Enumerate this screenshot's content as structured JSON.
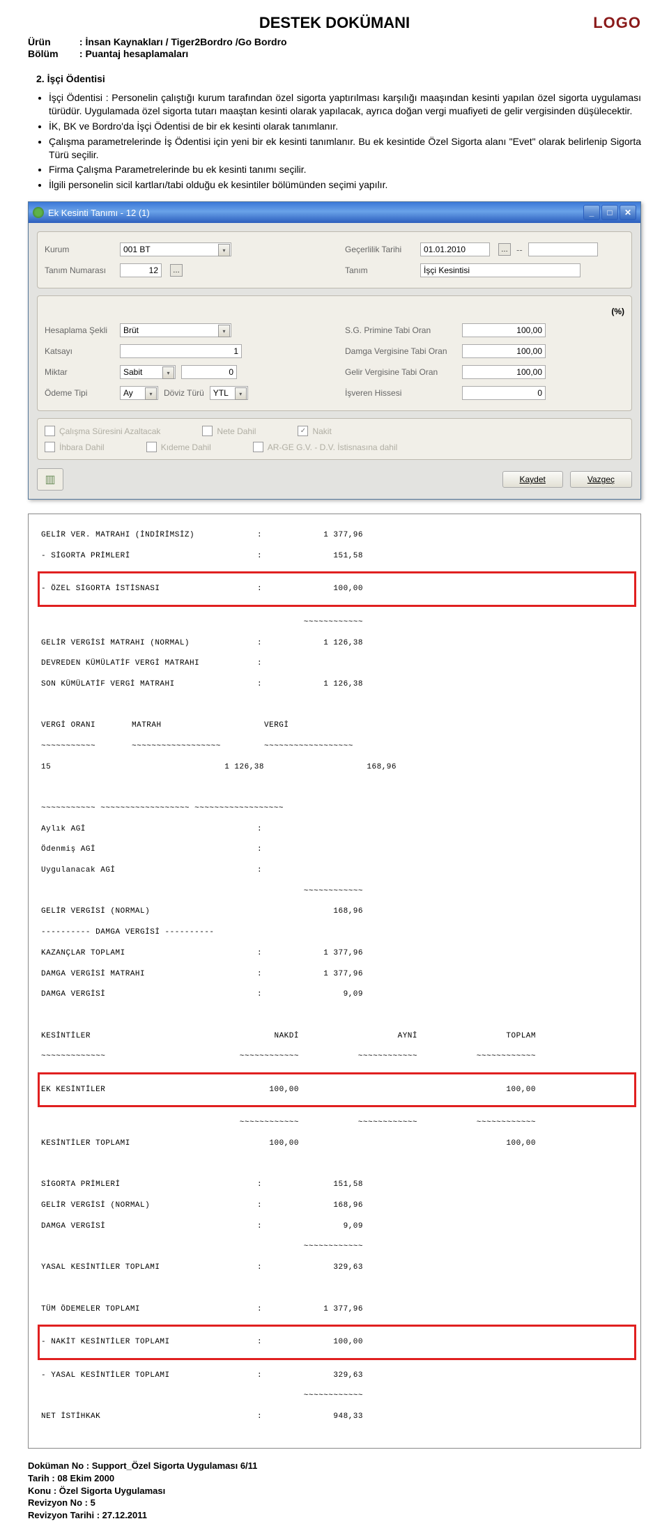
{
  "header": {
    "title": "DESTEK DOKÜMANI",
    "logo": "LOGO",
    "urun_label": "Ürün",
    "urun_value": ": İnsan Kaynakları / Tiger2Bordro /Go Bordro",
    "bolum_label": "Bölüm",
    "bolum_value": ": Puantaj hesaplamaları"
  },
  "section": {
    "heading": "2. İşçi Ödentisi",
    "bullets": [
      "İşçi Ödentisi : Personelin çalıştığı kurum tarafından özel sigorta yaptırılması karşılığı maaşından kesinti yapılan özel sigorta uygulaması türüdür. Uygulamada özel sigorta tutarı maaştan kesinti olarak yapılacak, ayrıca doğan vergi muafiyeti de gelir vergisinden düşülecektir.",
      "İK, BK ve Bordro'da İşçi Ödentisi de bir ek kesinti olarak tanımlanır.",
      "Çalışma parametrelerinde İş Ödentisi için yeni bir ek kesinti tanımlanır. Bu ek kesintide Özel Sigorta alanı \"Evet\" olarak belirlenip Sigorta Türü seçilir.",
      "Firma Çalışma Parametrelerinde bu ek kesinti tanımı seçilir.",
      "İlgili personelin sicil kartları/tabi olduğu ek kesintiler bölümünden seçimi yapılır."
    ]
  },
  "window": {
    "title": "Ek Kesinti Tanımı - 12 (1)",
    "labels": {
      "kurum": "Kurum",
      "gecerlilik": "Geçerlilik Tarihi",
      "dash": "--",
      "tanim_no": "Tanım Numarası",
      "tanim": "Tanım",
      "percent": "(%)",
      "hesaplama": "Hesaplama Şekli",
      "sg_prim": "S.G. Primine Tabi Oran",
      "katsayi": "Katsayı",
      "damga": "Damga Vergisine Tabi Oran",
      "miktar": "Miktar",
      "gelir": "Gelir Vergisine Tabi Oran",
      "odeme": "Ödeme Tipi",
      "doviz": "Döviz Türü",
      "isveren": "İşveren Hissesi",
      "calisma_suresi": "Çalışma Süresini Azaltacak",
      "nete": "Nete Dahil",
      "nakit": "Nakit",
      "ihbara": "İhbara Dahil",
      "kideme": "Kıdeme Dahil",
      "arge": "AR-GE G.V. - D.V. İstisnasına dahil"
    },
    "values": {
      "kurum": "001 BT",
      "gecerlilik": "01.01.2010",
      "tanim_no": "12",
      "tanim": "İşçi Kesintisi",
      "hesaplama": "Brüt",
      "sg_prim": "100,00",
      "katsayi": "1",
      "damga": "100,00",
      "miktar_type": "Sabit",
      "miktar_val": "0",
      "gelir": "100,00",
      "odeme": "Ay",
      "doviz": "YTL",
      "isveren": "0"
    },
    "buttons": {
      "kaydet": "Kaydet",
      "vazgec": "Vazgeç"
    }
  },
  "report": {
    "rows1": [
      {
        "l": "GELİR VER. MATRAHI (İNDİRİMSİZ)",
        "c": ":",
        "v": "1 377,96"
      },
      {
        "l": "- SİGORTA PRİMLERİ",
        "c": ":",
        "v": "151,58"
      }
    ],
    "ozel_sigorta": {
      "l": "- ÖZEL SİGORTA İSTİSNASI",
      "c": ":",
      "v": "100,00"
    },
    "tildes1": "~~~~~~~~~~~~",
    "rows2": [
      {
        "l": "GELİR VERGİSİ MATRAHI (NORMAL)",
        "c": ":",
        "v": "1 126,38"
      },
      {
        "l": "DEVREDEN KÜMÜLATİF VERGİ MATRAHI",
        "c": ":",
        "v": ""
      },
      {
        "l": "SON KÜMÜLATİF VERGİ MATRAHI",
        "c": ":",
        "v": "1 126,38"
      }
    ],
    "vergi_hdr": {
      "c1": "VERGİ ORANI",
      "c2": "MATRAH",
      "c3": "VERGİ"
    },
    "vergi_sep": "~~~~~~~~~~~",
    "vergi_row": {
      "c1": "15",
      "c2": "1 126,38",
      "c3": "168,96"
    },
    "tildes_row": "~~~~~~~~~~~ ~~~~~~~~~~~~~~~~~~ ~~~~~~~~~~~~~~~~~~",
    "rows3": [
      {
        "l": "Aylık AGİ",
        "c": ":",
        "v": ""
      },
      {
        "l": "Ödenmiş AGİ",
        "c": ":",
        "v": ""
      },
      {
        "l": "Uygulanacak AGİ",
        "c": ":",
        "v": ""
      }
    ],
    "rows4": [
      {
        "l": "GELİR VERGİSİ (NORMAL)",
        "c": "",
        "v": "168,96"
      },
      {
        "l": "---------- DAMGA VERGİSİ ----------",
        "c": "",
        "v": ""
      },
      {
        "l": "KAZANÇLAR TOPLAMI",
        "c": ":",
        "v": "1 377,96"
      },
      {
        "l": "DAMGA VERGİSİ MATRAHI",
        "c": ":",
        "v": "1 377,96"
      },
      {
        "l": "DAMGA VERGİSİ",
        "c": ":",
        "v": "9,09"
      }
    ],
    "kes_hdr": {
      "c1": "KESİNTİLER",
      "c2": "NAKDİ",
      "c3": "AYNİ",
      "c4": "TOPLAM"
    },
    "ek_kes": {
      "l": "EK KESİNTİLER",
      "v2": "100,00",
      "v4": "100,00"
    },
    "kes_top": {
      "l": "KESİNTİLER TOPLAMI",
      "v2": "100,00",
      "v4": "100,00"
    },
    "rows5": [
      {
        "l": "SİGORTA PRİMLERİ",
        "c": ":",
        "v": "151,58"
      },
      {
        "l": "GELİR VERGİSİ (NORMAL)",
        "c": ":",
        "v": "168,96"
      },
      {
        "l": "DAMGA VERGİSİ",
        "c": ":",
        "v": "9,09"
      }
    ],
    "yasal": {
      "l": "YASAL KESİNTİLER TOPLAMI",
      "c": ":",
      "v": "329,63"
    },
    "tum_odeme": {
      "l": "TÜM ÖDEMELER TOPLAMI",
      "c": ":",
      "v": "1 377,96"
    },
    "nakit_kes": {
      "l": "- NAKİT KESİNTİLER TOPLAMI",
      "c": ":",
      "v": "100,00"
    },
    "yasal_kes": {
      "l": "- YASAL KESİNTİLER TOPLAMI",
      "c": ":",
      "v": "329,63"
    },
    "net_ist": {
      "l": "NET İSTİHKAK",
      "c": ":",
      "v": "948,33"
    }
  },
  "footer": {
    "l1": "Doküman No : Support_Özel Sigorta Uygulaması    6/11",
    "l2": "Tarih : 08 Ekim 2000",
    "l3": "Konu : Özel Sigorta Uygulaması",
    "l4": "Revizyon No : 5",
    "l5": "Revizyon Tarihi : 27.12.2011"
  }
}
